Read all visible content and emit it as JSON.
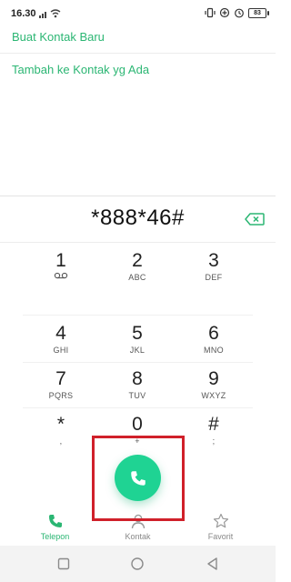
{
  "status_bar": {
    "time": "16.30",
    "battery": "83"
  },
  "options": {
    "create_new_contact": "Buat Kontak Baru",
    "add_to_existing": "Tambah ke Kontak yg Ada"
  },
  "dialer": {
    "entered_number": "*888*46#",
    "keys": [
      {
        "digit": "1",
        "letters": ""
      },
      {
        "digit": "2",
        "letters": "ABC"
      },
      {
        "digit": "3",
        "letters": "DEF"
      },
      {
        "digit": "4",
        "letters": "GHI"
      },
      {
        "digit": "5",
        "letters": "JKL"
      },
      {
        "digit": "6",
        "letters": "MNO"
      },
      {
        "digit": "7",
        "letters": "PQRS"
      },
      {
        "digit": "8",
        "letters": "TUV"
      },
      {
        "digit": "9",
        "letters": "WXYZ"
      },
      {
        "digit": "*",
        "letters": ","
      },
      {
        "digit": "0",
        "letters": "+"
      },
      {
        "digit": "#",
        "letters": ";"
      }
    ]
  },
  "tabs": [
    {
      "label": "Telepon",
      "icon": "phone-icon",
      "active": true
    },
    {
      "label": "Kontak",
      "icon": "person-icon",
      "active": false
    },
    {
      "label": "Favorit",
      "icon": "star-icon",
      "active": false
    }
  ],
  "colors": {
    "accent": "#2bb673",
    "call_button": "#1fd393",
    "highlight": "#d0202a"
  }
}
